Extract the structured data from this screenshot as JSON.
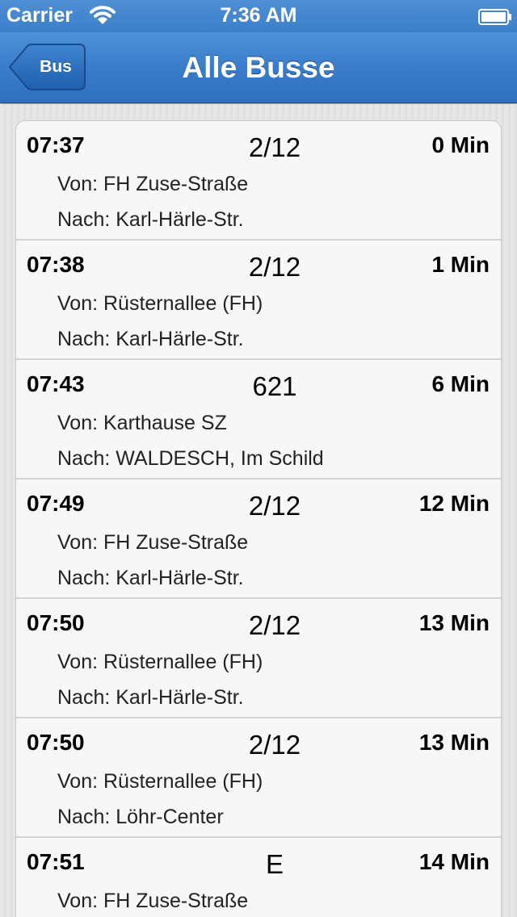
{
  "status_bar": {
    "carrier": "Carrier",
    "time": "7:36 AM",
    "wifi_icon": "wifi-icon",
    "battery_icon": "battery-icon"
  },
  "nav": {
    "back_label": "Bus",
    "title": "Alle Busse",
    "bar_color": "#3a7ccb"
  },
  "departures": [
    {
      "time": "07:37",
      "line": "2/12",
      "wait": "0 Min",
      "from": "Von: FH Zuse-Straße",
      "to": "Nach: Karl-Härle-Str."
    },
    {
      "time": "07:38",
      "line": "2/12",
      "wait": "1 Min",
      "from": "Von: Rüsternallee (FH)",
      "to": "Nach: Karl-Härle-Str."
    },
    {
      "time": "07:43",
      "line": "621",
      "wait": "6 Min",
      "from": "Von: Karthause SZ",
      "to": "Nach: WALDESCH, Im Schild"
    },
    {
      "time": "07:49",
      "line": "2/12",
      "wait": "12 Min",
      "from": "Von: FH Zuse-Straße",
      "to": "Nach: Karl-Härle-Str."
    },
    {
      "time": "07:50",
      "line": "2/12",
      "wait": "13 Min",
      "from": "Von: Rüsternallee (FH)",
      "to": "Nach: Karl-Härle-Str."
    },
    {
      "time": "07:50",
      "line": "2/12",
      "wait": "13 Min",
      "from": "Von: Rüsternallee (FH)",
      "to": "Nach: Löhr-Center"
    },
    {
      "time": "07:51",
      "line": "E",
      "wait": "14 Min",
      "from": "Von: FH Zuse-Straße",
      "to": ""
    }
  ]
}
